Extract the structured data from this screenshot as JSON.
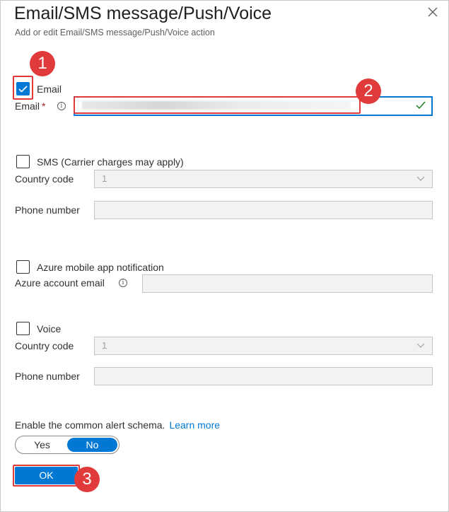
{
  "header": {
    "title": "Email/SMS message/Push/Voice",
    "subtitle": "Add or edit Email/SMS message/Push/Voice action"
  },
  "email": {
    "checkbox_label": "Email",
    "checked": true,
    "field_label": "Email",
    "required_mark": "*",
    "value": ""
  },
  "sms": {
    "checkbox_label": "SMS (Carrier charges may apply)",
    "checked": false,
    "country_code_label": "Country code",
    "country_code_value": "1",
    "phone_label": "Phone number",
    "phone_value": ""
  },
  "push": {
    "checkbox_label": "Azure mobile app notification",
    "checked": false,
    "account_email_label": "Azure account email",
    "account_email_value": ""
  },
  "voice": {
    "checkbox_label": "Voice",
    "checked": false,
    "country_code_label": "Country code",
    "country_code_value": "1",
    "phone_label": "Phone number",
    "phone_value": ""
  },
  "schema": {
    "label": "Enable the common alert schema.",
    "learn_more": "Learn more",
    "yes_label": "Yes",
    "no_label": "No",
    "selected": "No"
  },
  "actions": {
    "ok_label": "OK"
  },
  "annotations": {
    "step1": "1",
    "step2": "2",
    "step3": "3"
  },
  "colors": {
    "accent": "#0078d4",
    "annotation": "#e03a3a",
    "required": "#a4262c"
  },
  "icons": [
    "close-icon",
    "info-icon",
    "checkmark-icon",
    "chevron-down-icon"
  ]
}
